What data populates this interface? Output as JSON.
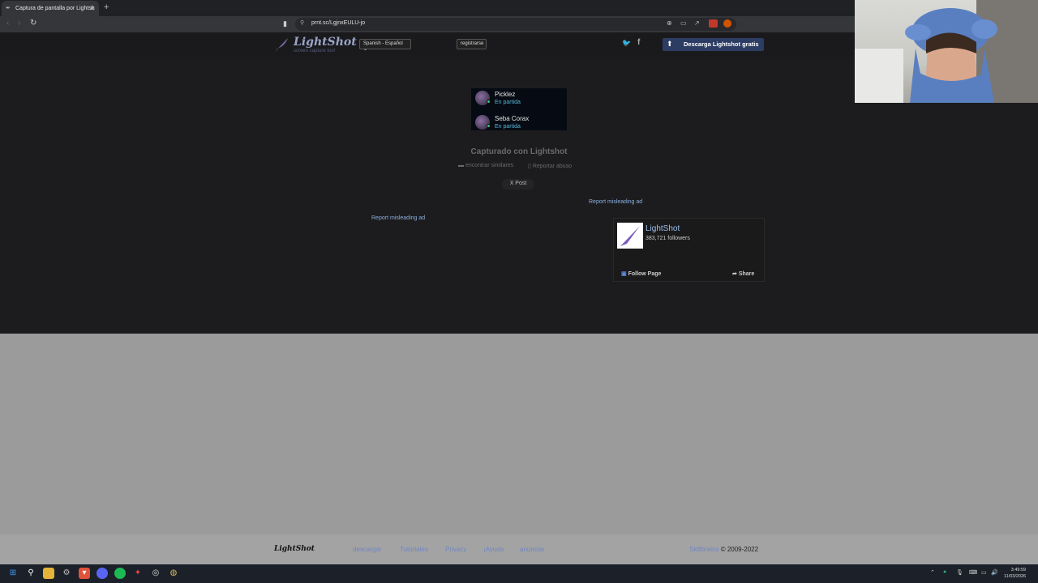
{
  "browser": {
    "tab_title": "Captura de pantalla por Lightsh",
    "url": "prnt.sc/LgjnxEULU-jo"
  },
  "header": {
    "logo": "LightShot",
    "logo_sub": "screen capture tool",
    "language": "Spanish - Español",
    "register": "registrarse",
    "download": "Descarga Lightshot gratis"
  },
  "screenshot": {
    "players": [
      {
        "name": "Picklez",
        "status": "En partida"
      },
      {
        "name": "Seba Corax",
        "status": "En partida"
      }
    ]
  },
  "main": {
    "captured": "Capturado con Lightshot",
    "find_similar": "encontrar similares",
    "report_abuse": "Reportar abuso",
    "post": "X Post",
    "report_ad_right": "Report misleading ad",
    "report_ad_left": "Report misleading ad"
  },
  "fb": {
    "name": "LightShot",
    "followers": "383,721 followers",
    "follow": "Follow Page",
    "share": "Share"
  },
  "footer": {
    "logo": "LightShot",
    "links": [
      "descargar",
      "Tutoriales",
      "Privacy",
      "¡Ayuda",
      "anunciar"
    ],
    "company": "Skillbrains",
    "copyright": "© 2009-2022"
  },
  "taskbar": {
    "time": "3:49:59",
    "date": "11/03/2026"
  }
}
